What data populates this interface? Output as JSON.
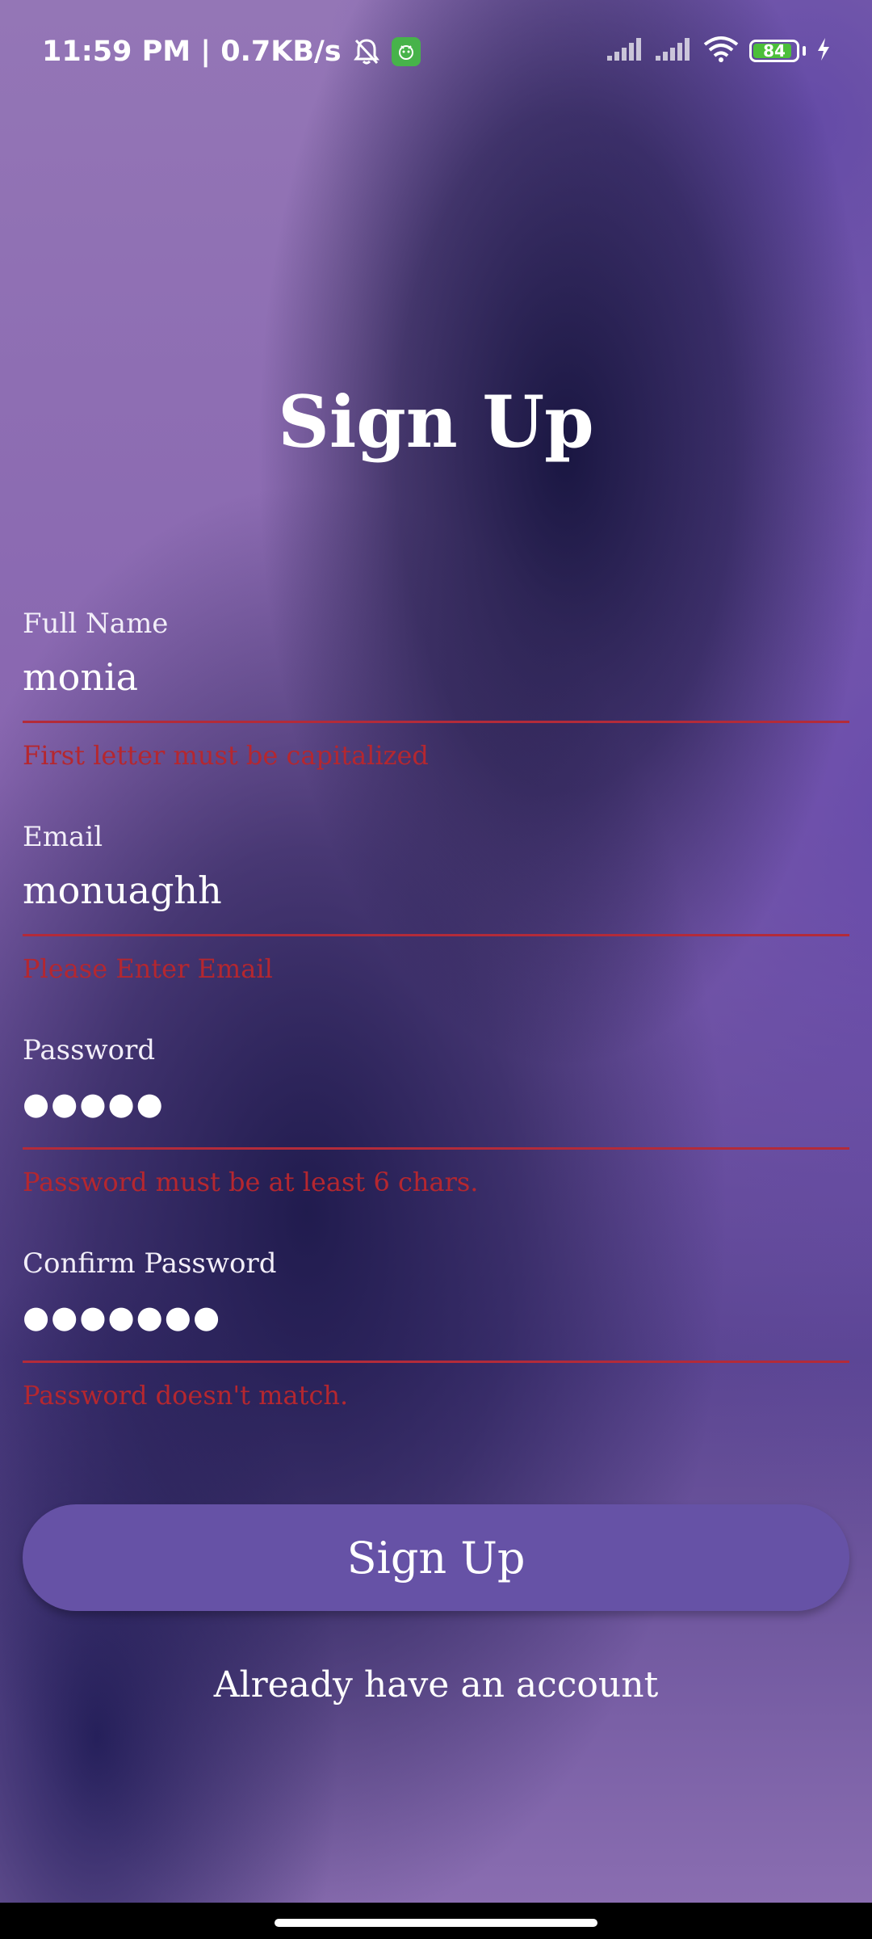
{
  "status_bar": {
    "time_speed": "11:59 PM | 0.7KB/s",
    "battery_level": "84",
    "icons": [
      "bell-muted-icon",
      "app-notification-icon",
      "signal-icon",
      "signal-icon",
      "wifi-icon",
      "battery-icon",
      "charging-icon"
    ]
  },
  "page": {
    "title": "Sign Up"
  },
  "form": {
    "full_name": {
      "label": "Full Name",
      "value": "monia",
      "error": "First letter must be capitalized"
    },
    "email": {
      "label": "Email",
      "value": "monuaghh",
      "error": "Please Enter Email"
    },
    "password": {
      "label": "Password",
      "value": "●●●●●",
      "error": "Password must be at least 6 chars."
    },
    "confirm_password": {
      "label": "Confirm Password",
      "value": "●●●●●●●",
      "error": "Password doesn't match."
    }
  },
  "actions": {
    "signup_label": "Sign Up",
    "login_link": "Already have an account"
  },
  "colors": {
    "error": "#b5272f",
    "button": "#6652a6",
    "background": "#8c6fb3"
  }
}
